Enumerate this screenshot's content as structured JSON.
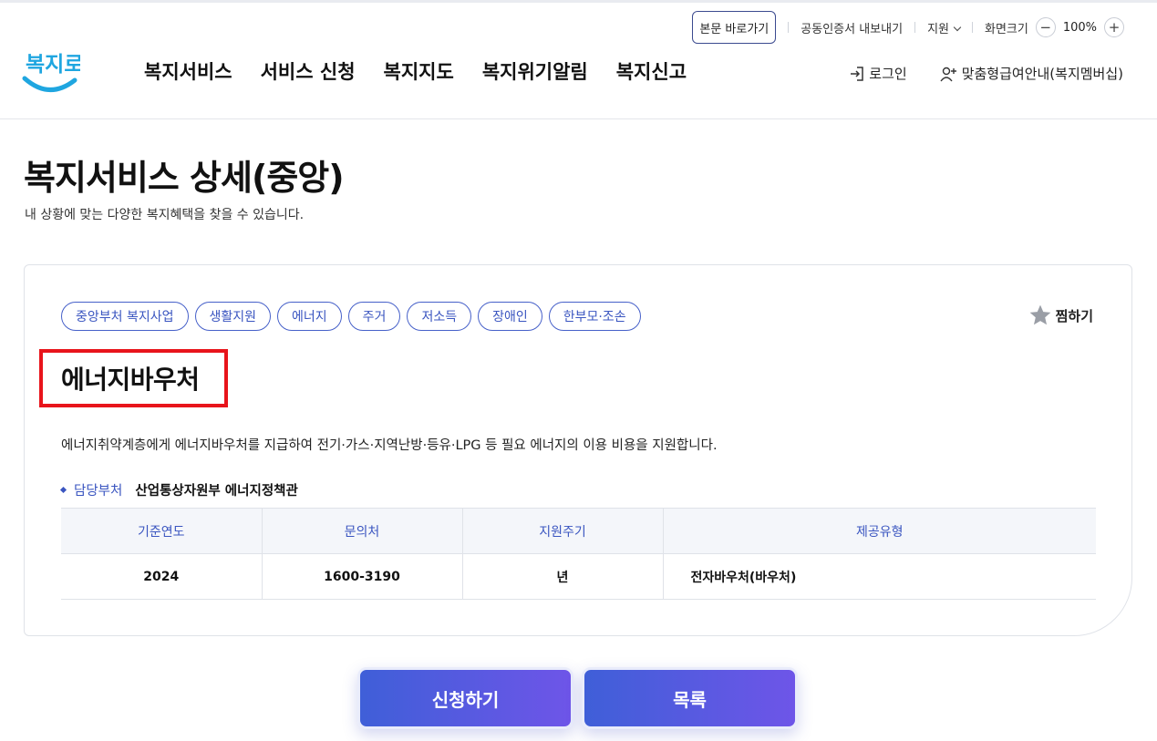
{
  "util": {
    "skip_label": "본문 바로가기",
    "cert_label": "공동인증서 내보내기",
    "support_label": "지원",
    "zoom_label": "화면크기",
    "zoom_value": "100%",
    "zoom_out": "−",
    "zoom_in": "+"
  },
  "header": {
    "logo_text": "복지로",
    "nav": [
      "복지서비스",
      "서비스 신청",
      "복지지도",
      "복지위기알림",
      "복지신고"
    ],
    "login_label": "로그인",
    "member_label": "맞춤형급여안내(복지멤버십)"
  },
  "page": {
    "title": "복지서비스 상세(중앙)",
    "description": "내 상황에 맞는 다양한 복지혜택을 찾을 수 있습니다."
  },
  "service": {
    "tags": [
      "중앙부처 복지사업",
      "생활지원",
      "에너지",
      "주거",
      "저소득",
      "장애인",
      "한부모·조손"
    ],
    "favorite_label": "찜하기",
    "name": "에너지바우처",
    "summary": "에너지취약계층에게 에너지바우처를 지급하여 전기·가스·지역난방·등유·LPG 등 필요 에너지의 이용 비용을 지원합니다.",
    "dept_label": "담당부처",
    "dept_value": "산업통상자원부 에너지정책관",
    "table": {
      "headers": [
        "기준연도",
        "문의처",
        "지원주기",
        "제공유형"
      ],
      "row": [
        "2024",
        "1600-3190",
        "년",
        "전자바우처(바우처)"
      ]
    }
  },
  "actions": {
    "apply_label": "신청하기",
    "list_label": "목록"
  },
  "colors": {
    "accent": "#3a55c0",
    "highlight_box": "#e8141b",
    "button_start": "#3f5fd8",
    "button_end": "#6e55e8"
  }
}
